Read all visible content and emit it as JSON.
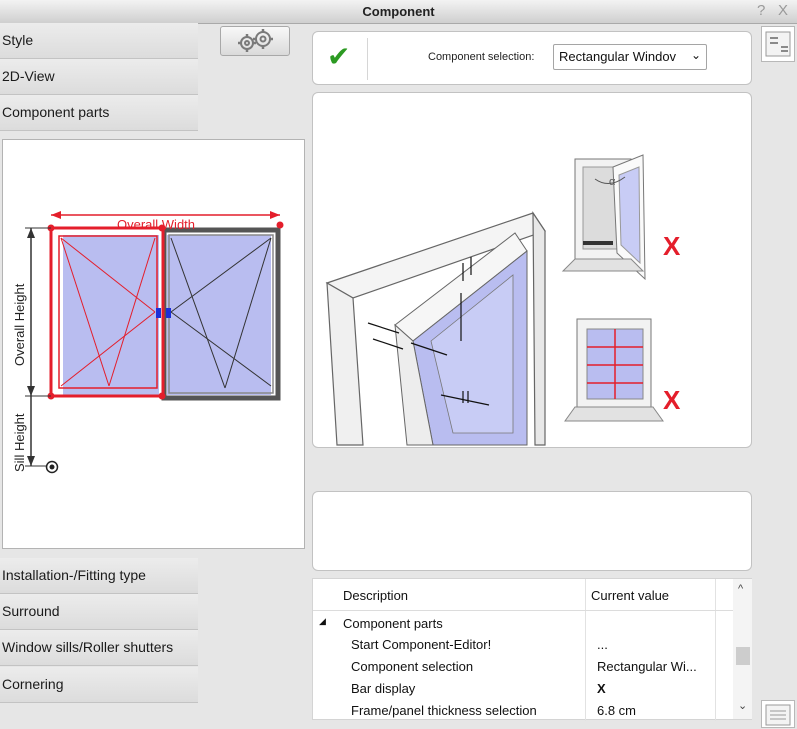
{
  "window": {
    "title": "Component",
    "help_label": "?",
    "close_label": "X"
  },
  "sidebar": {
    "top_items": [
      {
        "label": "Style"
      },
      {
        "label": "2D-View"
      },
      {
        "label": "Component parts"
      }
    ],
    "bottom_items": [
      {
        "label": "Installation-/Fitting type"
      },
      {
        "label": "Surround"
      },
      {
        "label": "Window sills/Roller shutters"
      },
      {
        "label": "Cornering"
      }
    ]
  },
  "preview": {
    "width_label": "Overall Width",
    "height_label": "Overall Height",
    "sill_label": "Sill Height"
  },
  "toolbar": {
    "gear_icon": "gear-icon",
    "confirm_glyph": "✔",
    "component_selection_label": "Component selection:",
    "component_selection_value": "Rectangular Windov",
    "dropdown_glyph": "⌄"
  },
  "illustration": {
    "angle_label": "α",
    "cross_glyph": "X"
  },
  "grid": {
    "headers": {
      "description": "Description",
      "current_value": "Current value"
    },
    "group": {
      "label": "Component parts",
      "expand_glyph": "◢"
    },
    "rows": [
      {
        "description": "Start Component-Editor!",
        "value": "..."
      },
      {
        "description": "Component selection",
        "value": "Rectangular Wi..."
      },
      {
        "description": "Bar display",
        "value": "X"
      },
      {
        "description": "Frame/panel thickness selection",
        "value": "6.8 cm"
      }
    ],
    "scroll_up": "^",
    "scroll_down": "⌄"
  },
  "colors": {
    "accent_red": "#e41e2b",
    "check_green": "#2c9a22",
    "glass_blue": "#b9bdf0"
  }
}
